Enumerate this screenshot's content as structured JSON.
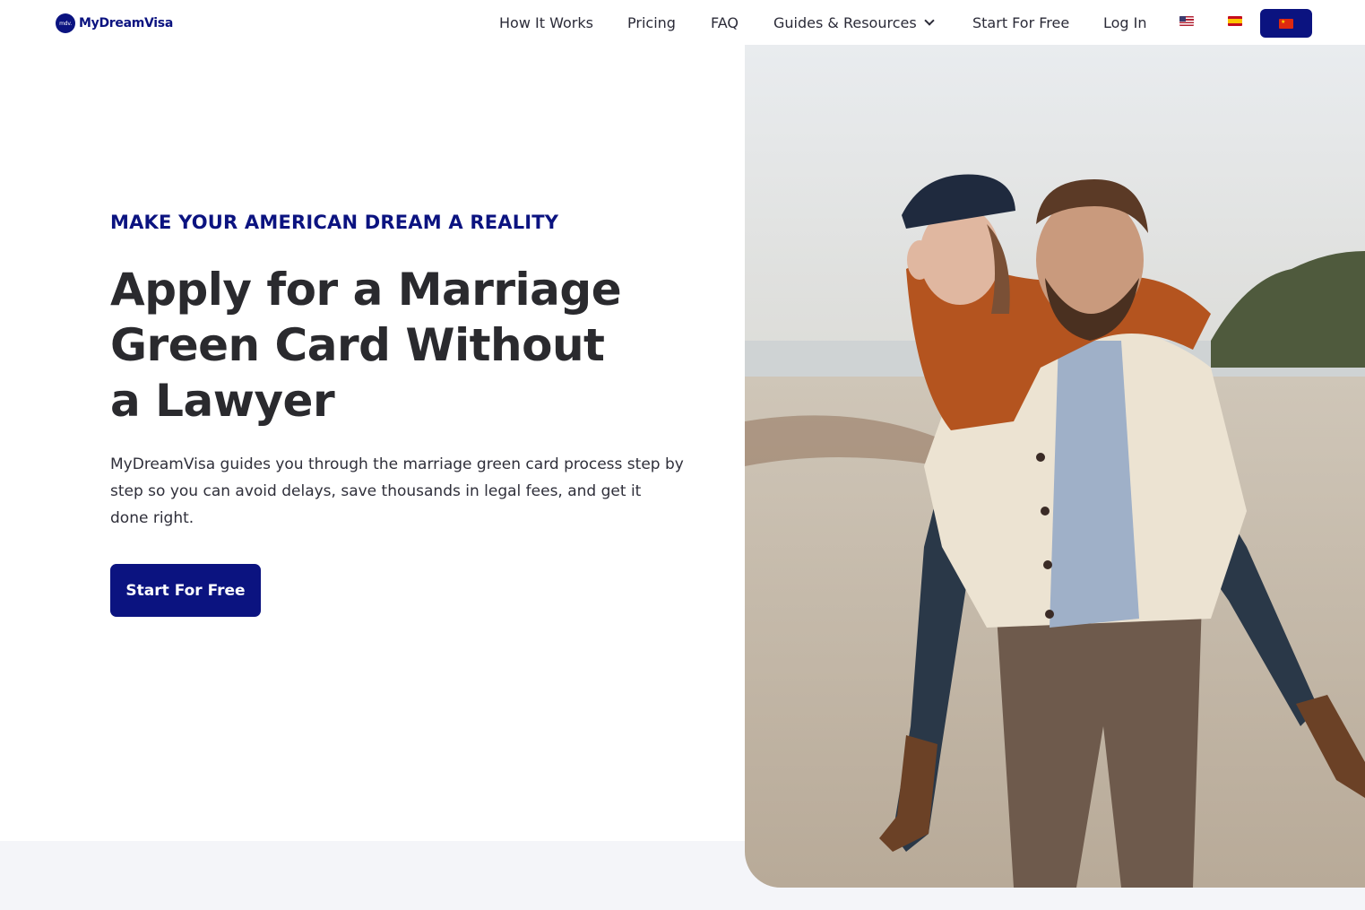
{
  "brand": {
    "logo_mark": "mdv.",
    "name": "MyDreamVisa",
    "color": "#0b1380"
  },
  "nav": {
    "how_it_works": "How It Works",
    "pricing": "Pricing",
    "faq": "FAQ",
    "guides": "Guides & Resources",
    "start_free": "Start For Free",
    "login": "Log In"
  },
  "languages": {
    "options": [
      "us-flag-icon",
      "spain-flag-icon",
      "china-flag-icon"
    ],
    "selected": "china-flag-icon"
  },
  "hero": {
    "eyebrow": "MAKE YOUR AMERICAN DREAM A REALITY",
    "headline": "Apply for a Marriage Green Card Without a Lawyer",
    "subcopy": "MyDreamVisa guides you through the marriage green card process step by step so you can avoid delays, save thousands in legal fees, and get it done right.",
    "cta": "Start For Free",
    "image_subject": "couple-on-beach-photo"
  },
  "colors": {
    "accent": "#0b1380",
    "text": "#2a2a2e",
    "band": "#f4f5f9"
  }
}
